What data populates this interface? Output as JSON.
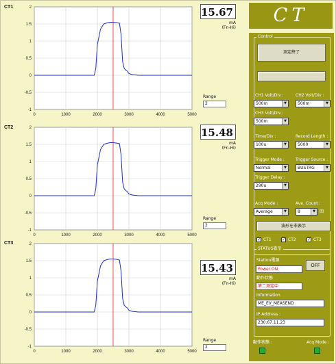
{
  "channels": [
    {
      "label": "CT1",
      "value": "15.67",
      "unit": "mA",
      "mode": "(Fn-Hi)",
      "range_label": "Range",
      "range_value": "2"
    },
    {
      "label": "CT2",
      "value": "15.48",
      "unit": "mA",
      "mode": "(Fn-Hi)",
      "range_label": "Range",
      "range_value": "2"
    },
    {
      "label": "CT3",
      "value": "15.43",
      "unit": "mA",
      "mode": "(Fn-Hi)",
      "range_label": "Range",
      "range_value": "2"
    }
  ],
  "chart_data": [
    {
      "type": "line",
      "xlim": [
        0,
        5000
      ],
      "ylim": [
        -1,
        2
      ],
      "xticks": [
        "0",
        "1000",
        "2000",
        "3000",
        "4000",
        "5000"
      ],
      "yticks": [
        "2",
        "1.5",
        "1",
        "0.5",
        "0",
        "-0.5",
        "-1"
      ],
      "cursor_x": 2500,
      "series": [
        {
          "x": [
            0,
            1900,
            1950,
            2000,
            2100,
            2200,
            2300,
            2400,
            2500,
            2600,
            2700,
            2750,
            2800,
            2850,
            2900,
            2950,
            3000,
            3100,
            3300,
            3600,
            4000,
            5000
          ],
          "values": [
            0,
            0,
            0.2,
            0.9,
            1.35,
            1.5,
            1.53,
            1.55,
            1.55,
            1.54,
            1.52,
            1.2,
            0.4,
            0.2,
            0.15,
            0.12,
            0.05,
            0.02,
            0,
            0,
            0,
            0
          ]
        }
      ]
    },
    {
      "type": "line",
      "xlim": [
        0,
        5000
      ],
      "ylim": [
        -1,
        2
      ],
      "xticks": [
        "0",
        "1000",
        "2000",
        "3000",
        "4000",
        "5000"
      ],
      "yticks": [
        "2",
        "1.5",
        "1",
        "0.5",
        "0",
        "-0.5",
        "-1"
      ],
      "cursor_x": 2500,
      "series": [
        {
          "x": [
            0,
            1900,
            1950,
            2000,
            2100,
            2200,
            2300,
            2400,
            2500,
            2600,
            2700,
            2750,
            2800,
            2850,
            2900,
            2950,
            3000,
            3100,
            3300,
            3600,
            4000,
            5000
          ],
          "values": [
            0,
            0,
            0.2,
            0.9,
            1.35,
            1.5,
            1.53,
            1.55,
            1.55,
            1.54,
            1.52,
            1.2,
            0.4,
            0.2,
            0.15,
            0.12,
            0.05,
            0.02,
            0,
            0,
            0,
            0
          ]
        }
      ]
    },
    {
      "type": "line",
      "xlim": [
        0,
        5000
      ],
      "ylim": [
        -1,
        2
      ],
      "xticks": [
        "0",
        "1000",
        "2000",
        "3000",
        "4000",
        "5000"
      ],
      "yticks": [
        "2",
        "1.5",
        "1",
        "0.5",
        "0",
        "-0.5",
        "-1"
      ],
      "cursor_x": 2500,
      "series": [
        {
          "x": [
            0,
            1900,
            1950,
            2000,
            2100,
            2200,
            2300,
            2400,
            2500,
            2600,
            2700,
            2750,
            2800,
            2850,
            2900,
            2950,
            3000,
            3100,
            3300,
            3600,
            4000,
            5000
          ],
          "values": [
            0,
            0,
            0.2,
            0.9,
            1.35,
            1.5,
            1.53,
            1.55,
            1.55,
            1.54,
            1.52,
            1.2,
            0.4,
            0.2,
            0.15,
            0.12,
            0.05,
            0.02,
            0,
            0,
            0,
            0
          ]
        }
      ]
    }
  ],
  "panel": {
    "title": "CT",
    "control_label": "Control",
    "stop_button": "測定終了",
    "ch1_label": "CH1 Volt/Div :",
    "ch1_value": "500m",
    "ch2_label": "CH2 Volt/Div :",
    "ch2_value": "500m",
    "ch3_label": "CH3 Volt/Div :",
    "ch3_value": "500m",
    "time_label": "Time/Div :",
    "time_value": "100u",
    "record_label": "Record Length :",
    "record_value": "5000",
    "trigmode_label": "Trigger Mode :",
    "trigmode_value": "Normal",
    "trigsrc_label": "Trigger Source :",
    "trigsrc_value": "BUSTRG",
    "trigdelay_label": "Trigger Delay :",
    "trigdelay_value": "290u",
    "acq_label": "Acq Mode :",
    "acq_value": "Average",
    "avg_label": "Ave. Count :",
    "avg_value": "8",
    "avg_unit": "回",
    "display_button": "波形を非表示",
    "checks": [
      "CT1",
      "CT2",
      "CT3"
    ],
    "status_label": "STATUS表示",
    "station_label": "Station電源",
    "station_value": "Power ON",
    "off_button": "OFF",
    "meas_label": "動作状態",
    "meas_value": "第二測定中",
    "info_label": "Information",
    "info_value": "ME_EV_MEASEND",
    "ip_label": "IP Address :",
    "ip_value": "230.67.11.23",
    "foot_left": "動作状態 :",
    "foot_right": "Acq Mode :",
    "colors": {
      "panel": "#9d9b15",
      "background": "#f6f5c8",
      "trace": "#1a2ad8",
      "cursor": "#e02020",
      "led": "#22b022"
    }
  }
}
